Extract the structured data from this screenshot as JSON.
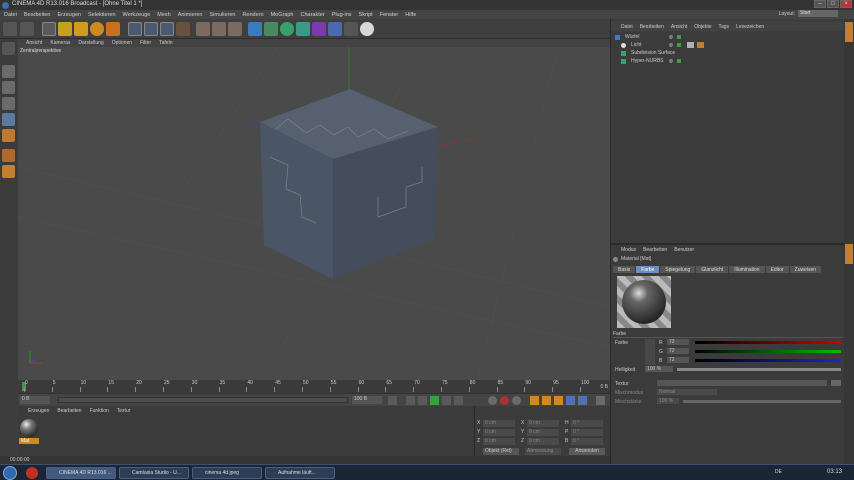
{
  "window": {
    "title": "CINEMA 4D R13.016 Broadcast - [Ohne Titel 1 *]"
  },
  "menubar": {
    "items": [
      "Datei",
      "Bearbeiten",
      "Erzeugen",
      "Selektieren",
      "Werkzeuge",
      "Mesh",
      "Animieren",
      "Simulieren",
      "Rendern",
      "MoGraph",
      "Charakter",
      "Plug-ins",
      "Skript",
      "Fenster",
      "Hilfe"
    ],
    "layout_label": "Layout:",
    "layout_value": "Start"
  },
  "viewport": {
    "menu": [
      "Ansicht",
      "Kameras",
      "Darstellung",
      "Optionen",
      "Filter",
      "Tafeln"
    ],
    "label": "Zentralperspektive"
  },
  "timeline": {
    "ticks": [
      "0",
      "5",
      "10",
      "15",
      "20",
      "25",
      "30",
      "35",
      "40",
      "45",
      "50",
      "55",
      "60",
      "65",
      "70",
      "75",
      "80",
      "85",
      "90",
      "95",
      "100"
    ],
    "frame_right": "0 B"
  },
  "transport": {
    "start": "0 B",
    "end": "100 B"
  },
  "material_manager": {
    "menu": [
      "Erzeugen",
      "Bearbeiten",
      "Funktion",
      "Textur"
    ],
    "material_name": "Mat"
  },
  "coordinates": {
    "rows": [
      {
        "a": "X",
        "av": "0 cm",
        "b": "X",
        "bv": "0 cm",
        "c": "H",
        "cv": "0 °"
      },
      {
        "a": "Y",
        "av": "0 cm",
        "b": "Y",
        "bv": "0 cm",
        "c": "P",
        "cv": "0 °"
      },
      {
        "a": "Z",
        "av": "0 cm",
        "b": "Z",
        "bv": "0 cm",
        "c": "B",
        "cv": "0 °"
      }
    ],
    "mode": "Objekt (Rel)",
    "size_mode": "Abmessung",
    "apply": "Anwenden"
  },
  "object_manager": {
    "menu": [
      "Datei",
      "Bearbeiten",
      "Ansicht",
      "Objekte",
      "Tags",
      "Lesezeichen"
    ],
    "objects": [
      "Würfel",
      "Licht",
      "Subdivision Surface",
      "Hyper-NURBS"
    ]
  },
  "attribute_manager": {
    "menu": [
      "Modus",
      "Bearbeiten",
      "Benutzer"
    ],
    "header": "Material [Mat]",
    "tabs": [
      "Basis",
      "Farbe",
      "Spiegelung",
      "Glanzlicht",
      "Illumination",
      "Editor",
      "Zuweisen"
    ],
    "active_tab": "Farbe",
    "section": "Farbe",
    "color_label": "Farbe",
    "r": "72",
    "g": "72",
    "b": "72",
    "brightness_label": "Helligkeit",
    "brightness_value": "100 %",
    "texture_label": "Textur",
    "mix_mode_label": "Mischmodus",
    "mix_mode_value": "Normal",
    "mix_strength_label": "Mischstärke",
    "mix_strength_value": "100 %"
  },
  "status": {
    "time": "00:00:00"
  },
  "taskbar": {
    "tasks": [
      "CINEMA 4D R13.016 ...",
      "Camtasia Studio - U...",
      "cinema 4d.jpeg",
      "Aufnahme läuft..."
    ],
    "lang": "DE",
    "clock": "03:13"
  },
  "colors": {
    "accent": "#6b8fbf",
    "axis_x": "#c03030",
    "axis_y": "#30a030",
    "axis_z": "#3050c0",
    "cube_front": "#4a5566",
    "cube_top": "#56606f",
    "cube_right": "#434d5c"
  }
}
